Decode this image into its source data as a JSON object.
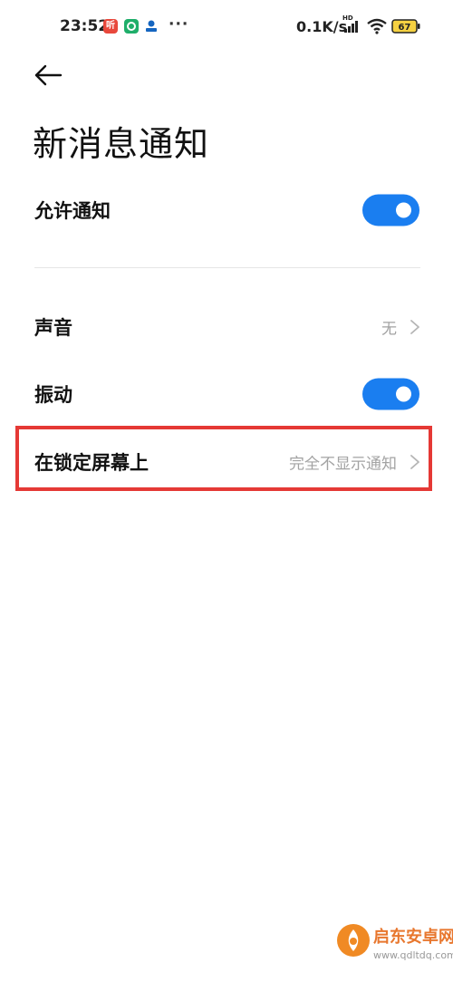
{
  "status_bar": {
    "time": "23:52",
    "app_icon_1": "听",
    "dots": "···",
    "net_speed": "0.1K/s",
    "battery_level": "67"
  },
  "header": {
    "title": "新消息通知"
  },
  "settings": {
    "allow_notifications": {
      "label": "允许通知",
      "enabled": true
    },
    "sound": {
      "label": "声音",
      "value": "无"
    },
    "vibration": {
      "label": "振动",
      "enabled": true
    },
    "lock_screen": {
      "label": "在锁定屏幕上",
      "value": "完全不显示通知"
    }
  },
  "watermark": {
    "brand": "启东安卓网",
    "url": "www.qdltdq.com"
  },
  "colors": {
    "accent": "#1a7ef0",
    "highlight": "#e53935",
    "muted_text": "#a3a3a3"
  }
}
